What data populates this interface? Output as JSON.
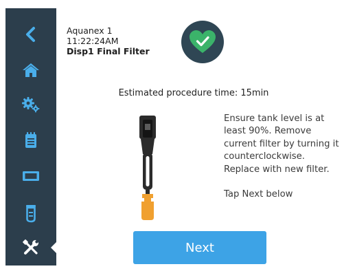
{
  "device": {
    "name": "Aquanex 1",
    "time": "11:22:24AM",
    "title": "Disp1 Final Filter"
  },
  "status": {
    "icon": "heart-check-icon",
    "color": "#3bb36a"
  },
  "procedure": {
    "estimated_time_text": "Estimated procedure time: 15min",
    "instructions": "Ensure tank level is at least 90%. Remove current filter by turning it counterclockwise. Replace with new filter.",
    "tap_next_text": "Tap Next below"
  },
  "actions": {
    "next_label": "Next"
  },
  "sidebar": {
    "items": [
      {
        "icon": "back-icon"
      },
      {
        "icon": "home-icon"
      },
      {
        "icon": "gears-icon"
      },
      {
        "icon": "clipboard-icon"
      },
      {
        "icon": "display-icon"
      },
      {
        "icon": "cylinder-icon"
      },
      {
        "icon": "tools-icon",
        "active": true
      }
    ]
  },
  "colors": {
    "sidebar": "#2c3e4c",
    "sidebar_icon": "#4aaeea",
    "button": "#3da3e6",
    "accent_orange": "#f0a030"
  }
}
